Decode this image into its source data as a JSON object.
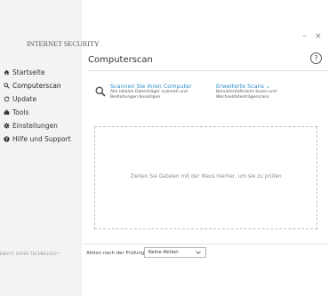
{
  "app": {
    "brand": "INTERNET SECURITY",
    "tagline": "ENUITY SAFER TECHNOLOGY™",
    "minimize_label": "–",
    "close_label": "×"
  },
  "sidebar": {
    "items": [
      {
        "label": "Startseite",
        "icon": "home-icon"
      },
      {
        "label": "Computerscan",
        "icon": "search-icon",
        "active": true
      },
      {
        "label": "Update",
        "icon": "refresh-icon"
      },
      {
        "label": "Tools",
        "icon": "toolbox-icon"
      },
      {
        "label": "Einstellungen",
        "icon": "gear-icon"
      },
      {
        "label": "Hilfe und Support",
        "icon": "help-icon"
      }
    ]
  },
  "main": {
    "title": "Computerscan",
    "help_label": "?",
    "scan": {
      "title": "Scannen Sie Ihren Computer",
      "desc_line1": "Alle lokalen Datenträger scannen und",
      "desc_line2": "Bedrohungen beseitigen"
    },
    "advanced": {
      "title": "Erweiterte Scans ⌄",
      "desc_line1": "Benutzerdefinierte Scans und",
      "desc_line2": "Wechseldatenträgerscans"
    },
    "dropzone_text": "Ziehen Sie Dateien mit der Maus hierher, um sie zu prüfen",
    "footer": {
      "after_label": "Aktion nach der Prüfung:",
      "select_value": "Keine Aktion"
    }
  },
  "colors": {
    "accent": "#2f8fc8",
    "sidebar_bg": "#f3f3f3"
  }
}
